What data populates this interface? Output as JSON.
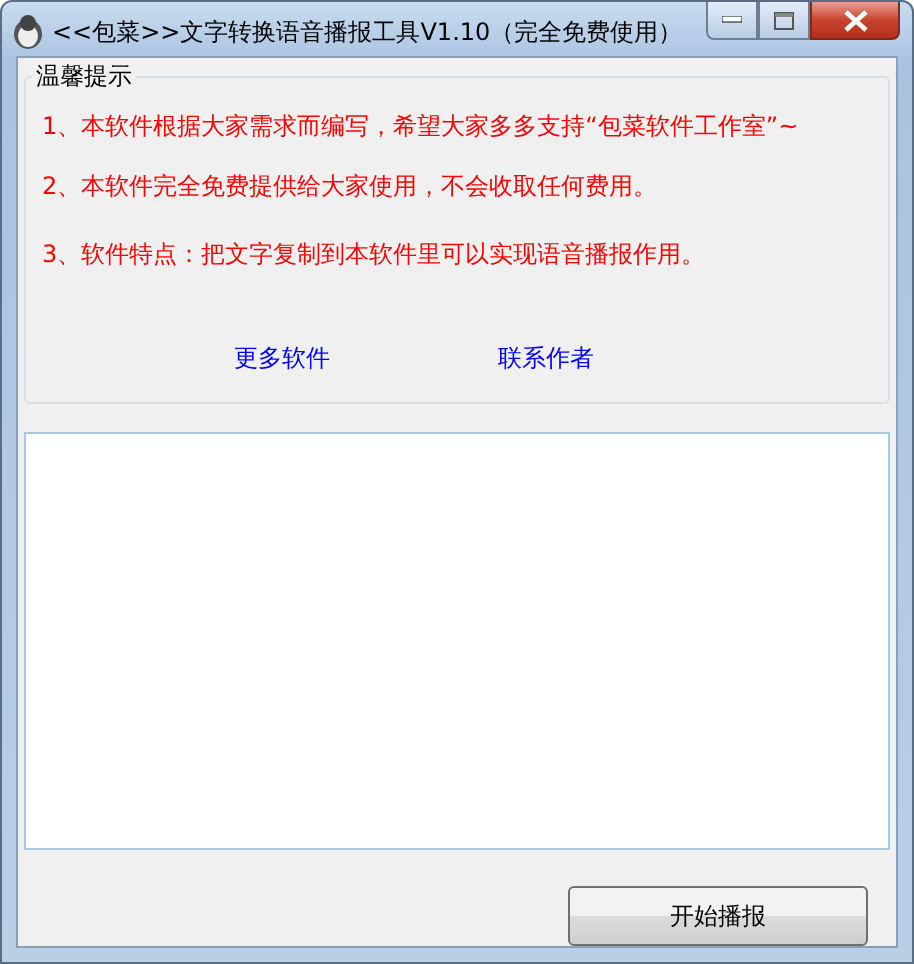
{
  "window": {
    "title": "<<包菜>>文字转换语音播报工具V1.10（完全免费使用）"
  },
  "notice": {
    "title": "温馨提示",
    "lines": [
      "1、本软件根据大家需求而编写，希望大家多多支持“包菜软件工作室”~",
      "2、本软件完全免费提供给大家使用，不会收取任何费用。",
      "3、软件特点：把文字复制到本软件里可以实现语音播报作用。"
    ],
    "links": [
      "更多软件",
      "联系作者"
    ]
  },
  "buttons": [
    "开始播报"
  ]
}
